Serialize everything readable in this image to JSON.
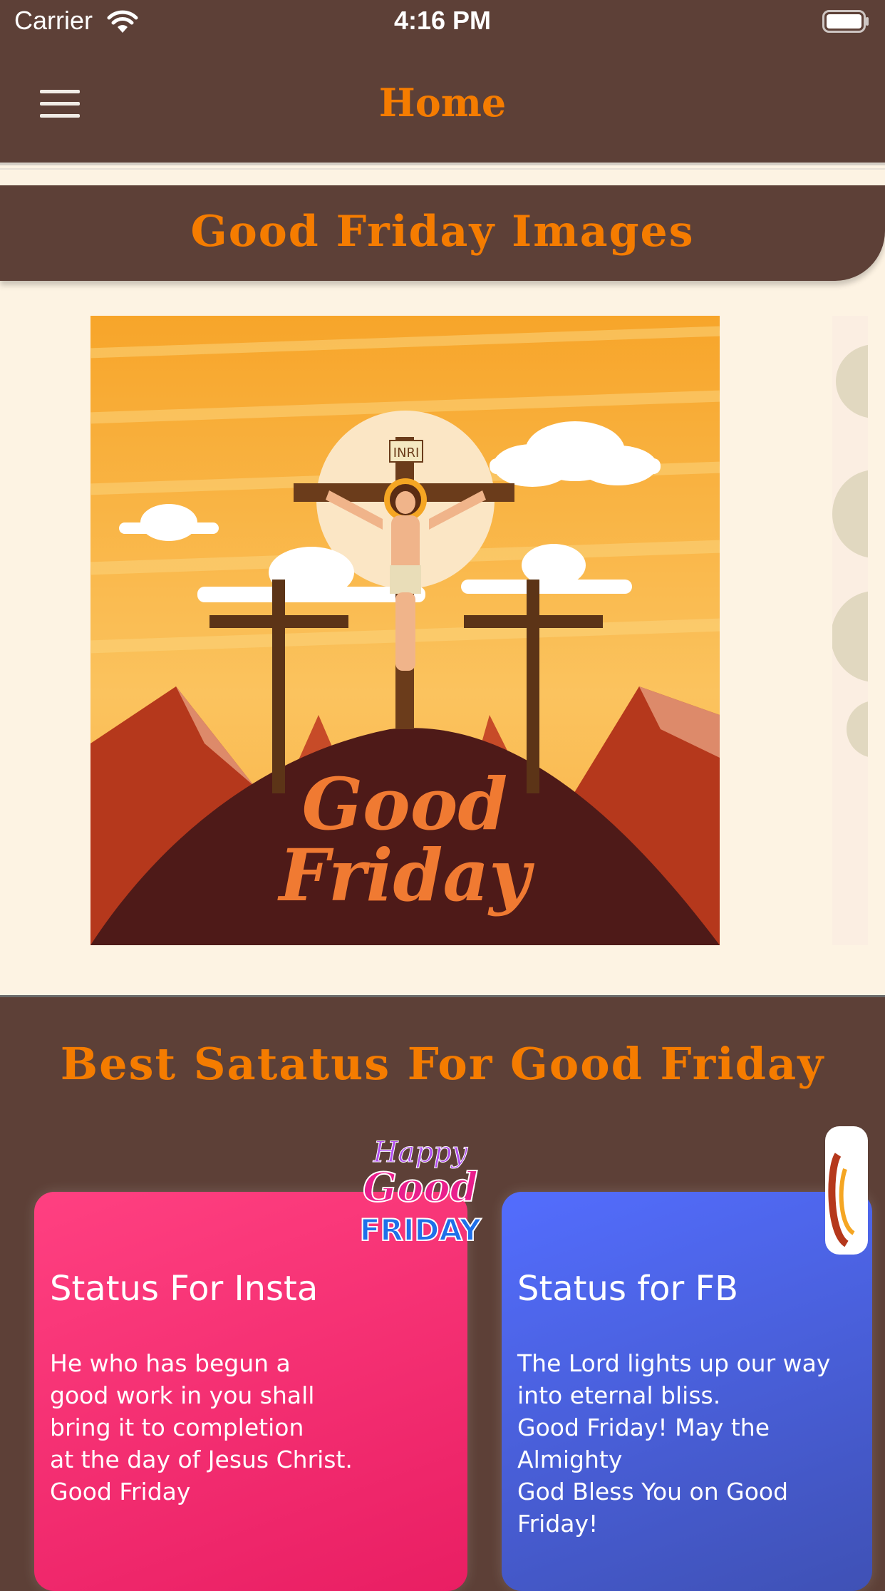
{
  "status_bar": {
    "carrier": "Carrier",
    "time": "4:16 PM"
  },
  "nav": {
    "title": "Home"
  },
  "images_section": {
    "title": "Good Friday Images",
    "image_caption_line1": "Good",
    "image_caption_line2": "Friday",
    "cross_label": "INRI"
  },
  "status_section": {
    "title": "Best Satatus For Good Friday",
    "sticker": {
      "line1": "Happy",
      "line2": "Good",
      "line3": "FRIDAY"
    },
    "cards": [
      {
        "title": "Status For Insta",
        "text": "He who has begun a\ngood work in you shall\nbring it to completion\nat the day of Jesus Christ.\nGood Friday"
      },
      {
        "title": "Status for FB",
        "text": "The Lord lights up our way\ninto eternal bliss.\nGood Friday! May the Almighty\nGod Bless You on Good Friday!"
      }
    ]
  },
  "colors": {
    "primary": "#5d4037",
    "accent": "#f57c00",
    "insta_card": "#ff4081",
    "fb_card": "#536dfe",
    "background": "#fdf3e3"
  }
}
